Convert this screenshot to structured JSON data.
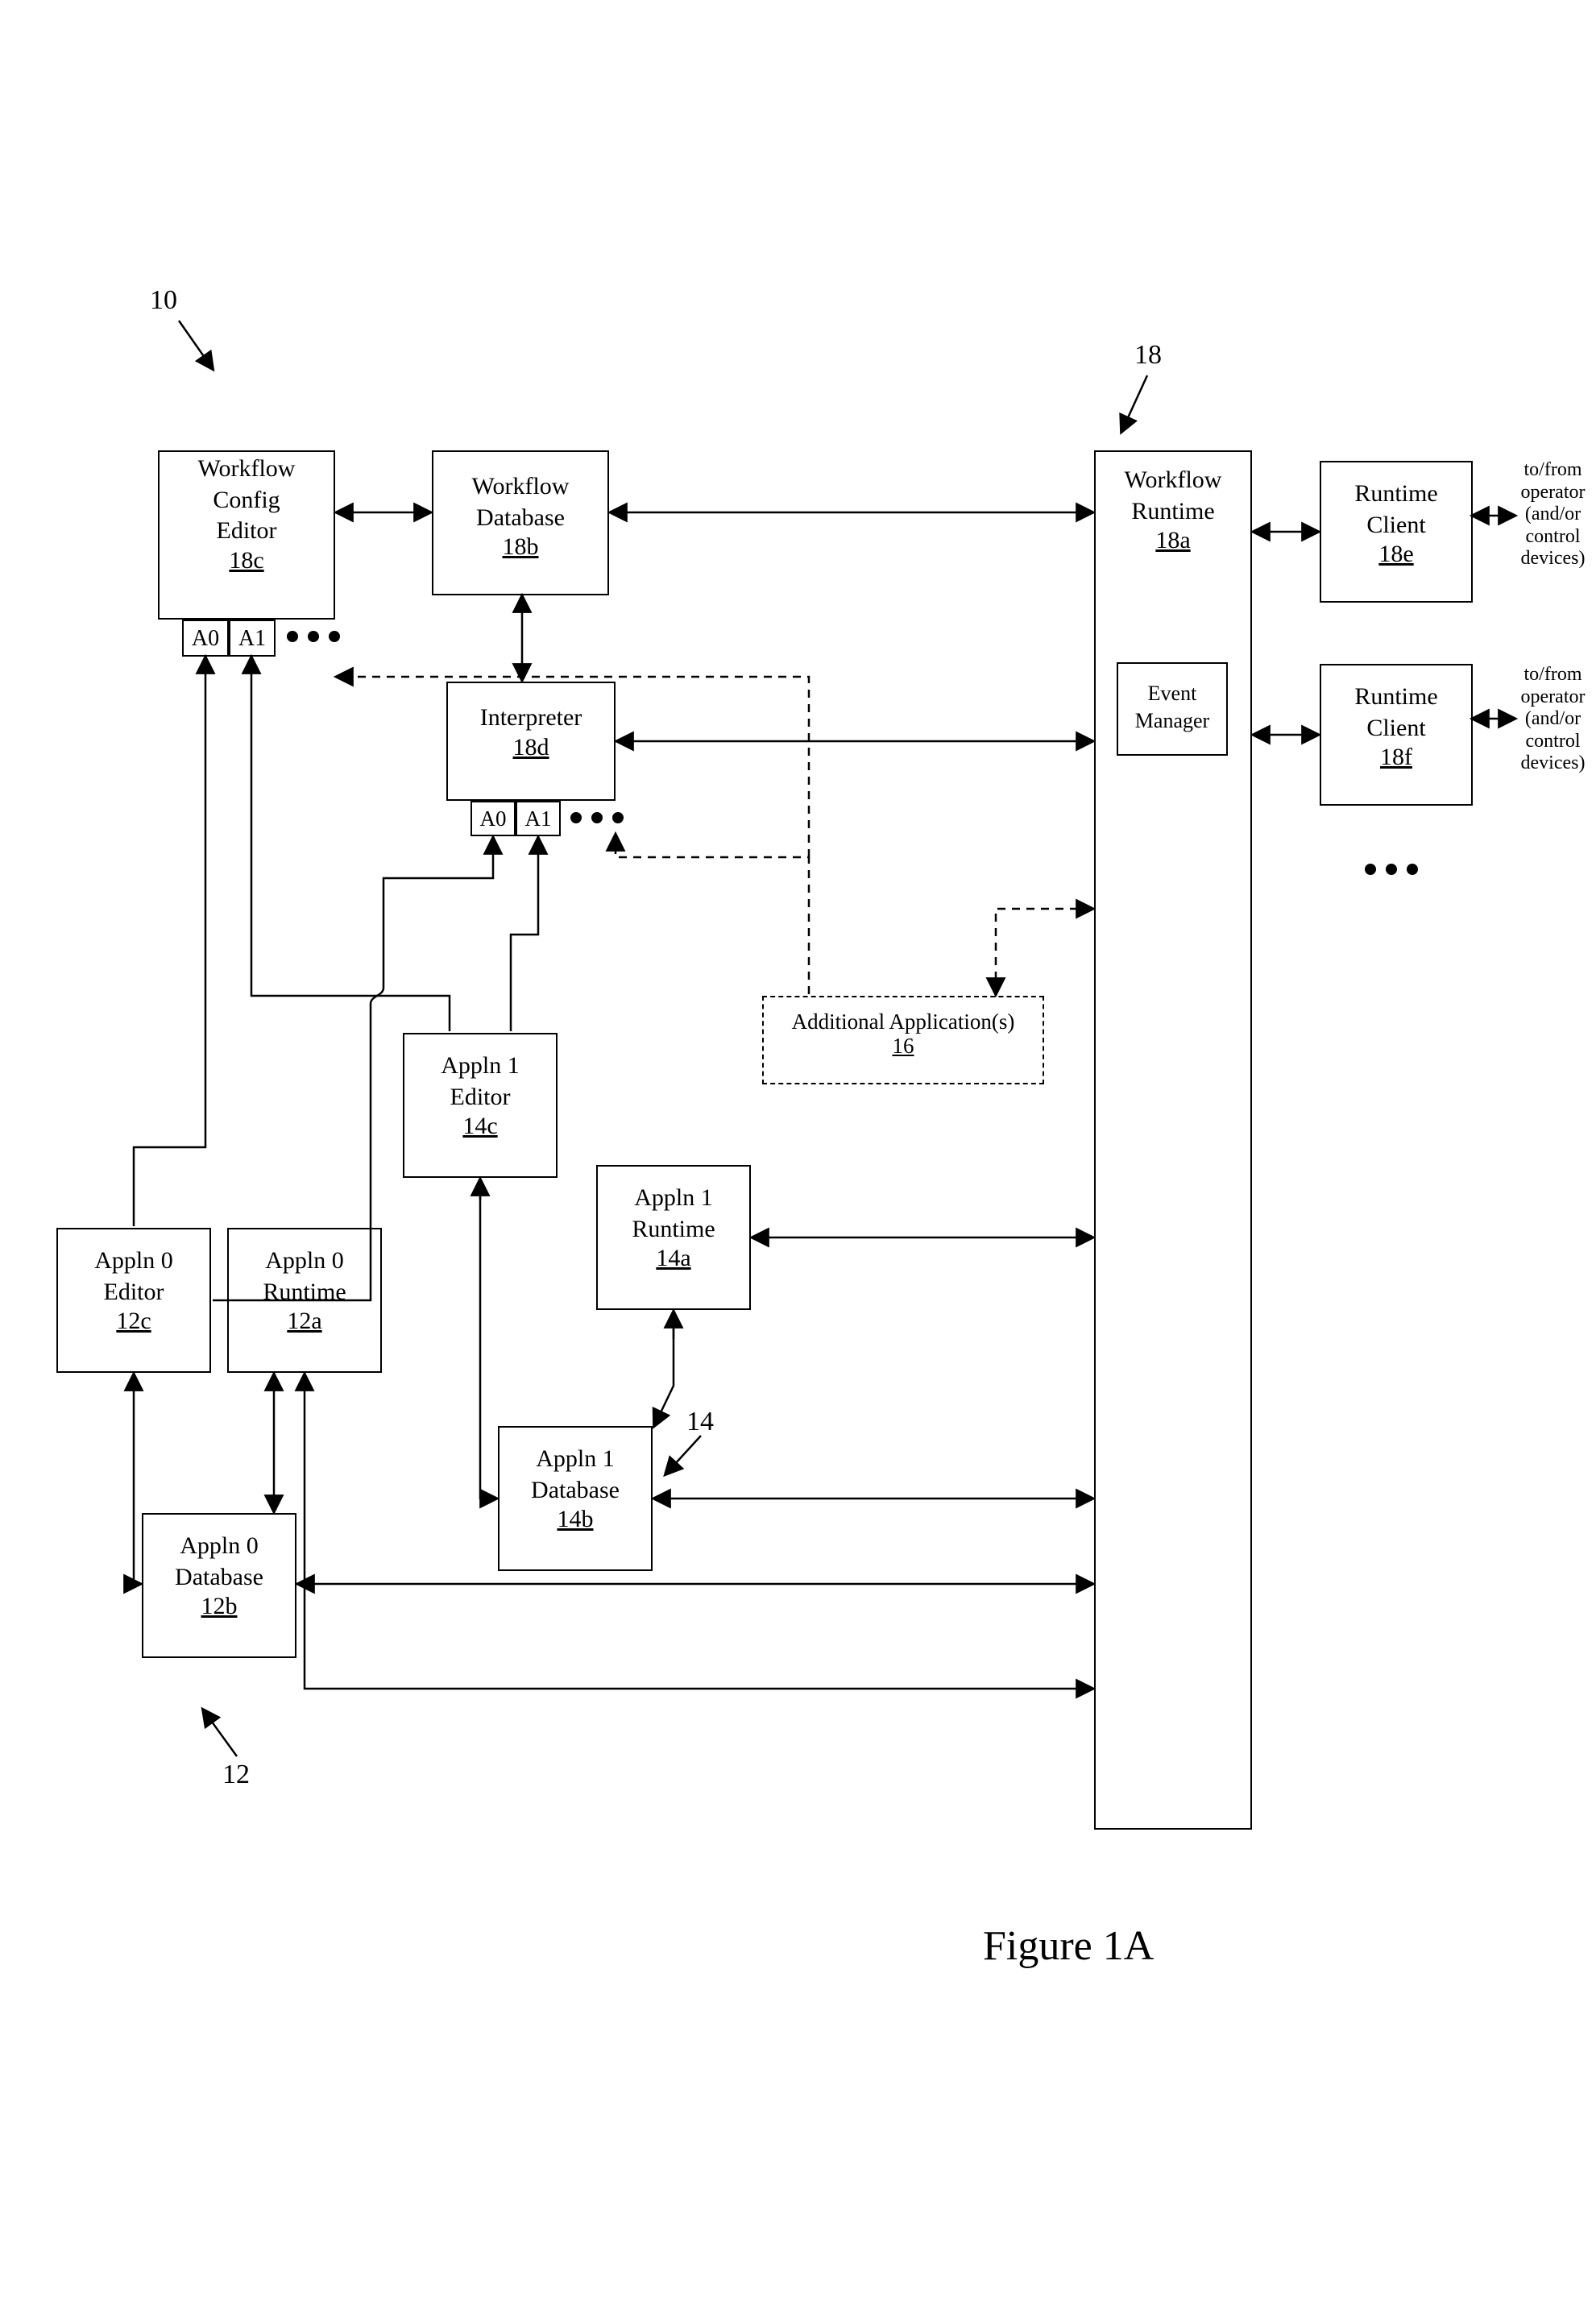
{
  "figure": {
    "caption": "Figure 1A",
    "ref_10": "10",
    "ref_12": "12",
    "ref_14": "14",
    "ref_18": "18"
  },
  "boxes": {
    "workflow_config_editor": {
      "title_l1": "Workflow",
      "title_l2": "Config",
      "title_l3": "Editor",
      "id": "18c"
    },
    "workflow_database": {
      "title_l1": "Workflow",
      "title_l2": "Database",
      "id": "18b"
    },
    "workflow_runtime": {
      "title_l1": "Workflow",
      "title_l2": "Runtime",
      "id": "18a"
    },
    "event_manager": {
      "title_l1": "Event",
      "title_l2": "Manager"
    },
    "interpreter": {
      "title": "Interpreter",
      "id": "18d"
    },
    "runtime_client_1": {
      "title_l1": "Runtime",
      "title_l2": "Client",
      "id": "18e"
    },
    "runtime_client_2": {
      "title_l1": "Runtime",
      "title_l2": "Client",
      "id": "18f"
    },
    "addl_apps": {
      "title": "Additional Application(s)",
      "id": "16"
    },
    "app0_editor": {
      "title_l1": "Appln 0",
      "title_l2": "Editor",
      "id": "12c"
    },
    "app0_runtime": {
      "title_l1": "Appln 0",
      "title_l2": "Runtime",
      "id": "12a"
    },
    "app0_database": {
      "title_l1": "Appln 0",
      "title_l2": "Database",
      "id": "12b"
    },
    "app1_editor": {
      "title_l1": "Appln 1",
      "title_l2": "Editor",
      "id": "14c"
    },
    "app1_runtime": {
      "title_l1": "Appln 1",
      "title_l2": "Runtime",
      "id": "14a"
    },
    "app1_database": {
      "title_l1": "Appln 1",
      "title_l2": "Database",
      "id": "14b"
    }
  },
  "tabs": {
    "wce_a0": "A0",
    "wce_a1": "A1",
    "intp_a0": "A0",
    "intp_a1": "A1"
  },
  "sidelabels": {
    "client1": {
      "l1": "to/from",
      "l2": "operator",
      "l3": "(and/or",
      "l4": "control",
      "l5": "devices)"
    },
    "client2": {
      "l1": "to/from",
      "l2": "operator",
      "l3": "(and/or",
      "l4": "control",
      "l5": "devices)"
    }
  }
}
